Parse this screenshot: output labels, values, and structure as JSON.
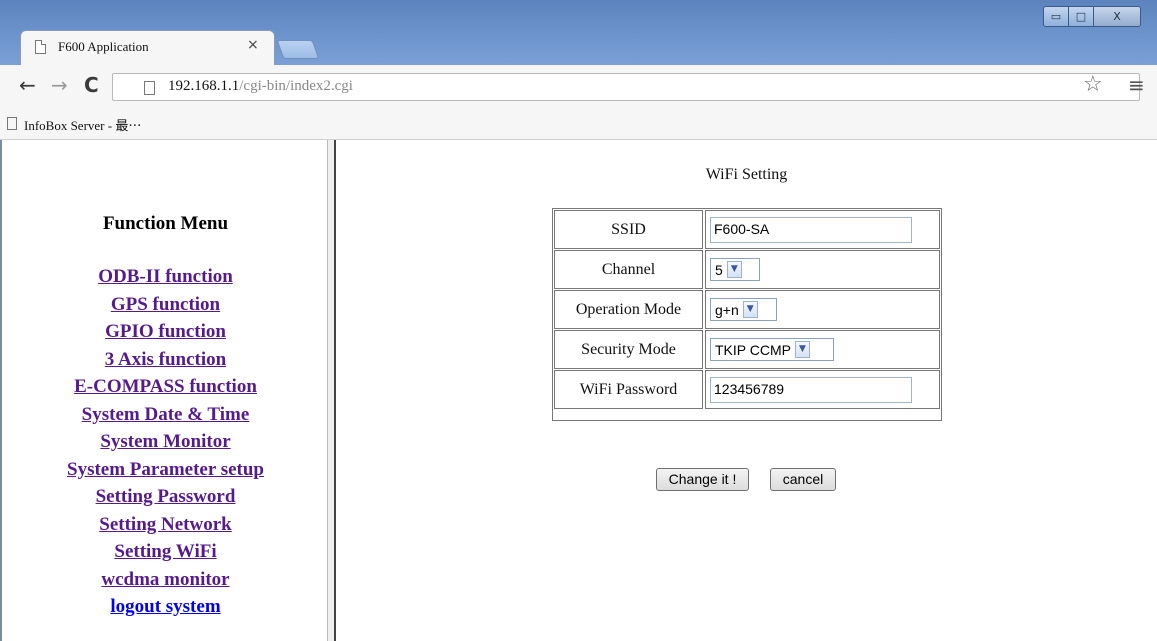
{
  "browser": {
    "tab_title": "F600 Application",
    "tab_close": "×",
    "url_host": "192.168.1.1",
    "url_path": "/cgi-bin/index2.cgi",
    "bookmark_label": "InfoBox Server - 最⋯",
    "nav_icons": {
      "back": "←",
      "forward": "→",
      "reload": "C",
      "star": "☆",
      "menu": "≡"
    },
    "window_controls": {
      "minimize": "▭",
      "maximize": "□",
      "close": "X"
    }
  },
  "menu": {
    "title": "Function Menu",
    "items": [
      {
        "label": "ODB-II function"
      },
      {
        "label": "GPS function"
      },
      {
        "label": "GPIO function"
      },
      {
        "label": "3 Axis function"
      },
      {
        "label": "E-COMPASS function"
      },
      {
        "label": "System Date & Time"
      },
      {
        "label": "System Monitor"
      },
      {
        "label": "System Parameter setup"
      },
      {
        "label": "Setting Password"
      },
      {
        "label": "Setting Network"
      },
      {
        "label": "Setting WiFi"
      },
      {
        "label": "wcdma monitor"
      },
      {
        "label": "logout system"
      }
    ]
  },
  "wifi": {
    "title": "WiFi Setting",
    "ssid_label": "SSID",
    "ssid_value": "F600-SA",
    "channel_label": "Channel",
    "channel_value": "5",
    "operation_mode_label": "Operation Mode",
    "operation_mode_value": "g+n",
    "security_mode_label": "Security Mode",
    "security_mode_value": "TKIP CCMP",
    "password_label": "WiFi Password",
    "password_value": "123456789",
    "change_button": "Change it !",
    "cancel_button": "cancel"
  },
  "colors": {
    "visited_link": "#551a8b",
    "unvisited_link": "#0000ee",
    "titlebar": "#6e94cd"
  }
}
